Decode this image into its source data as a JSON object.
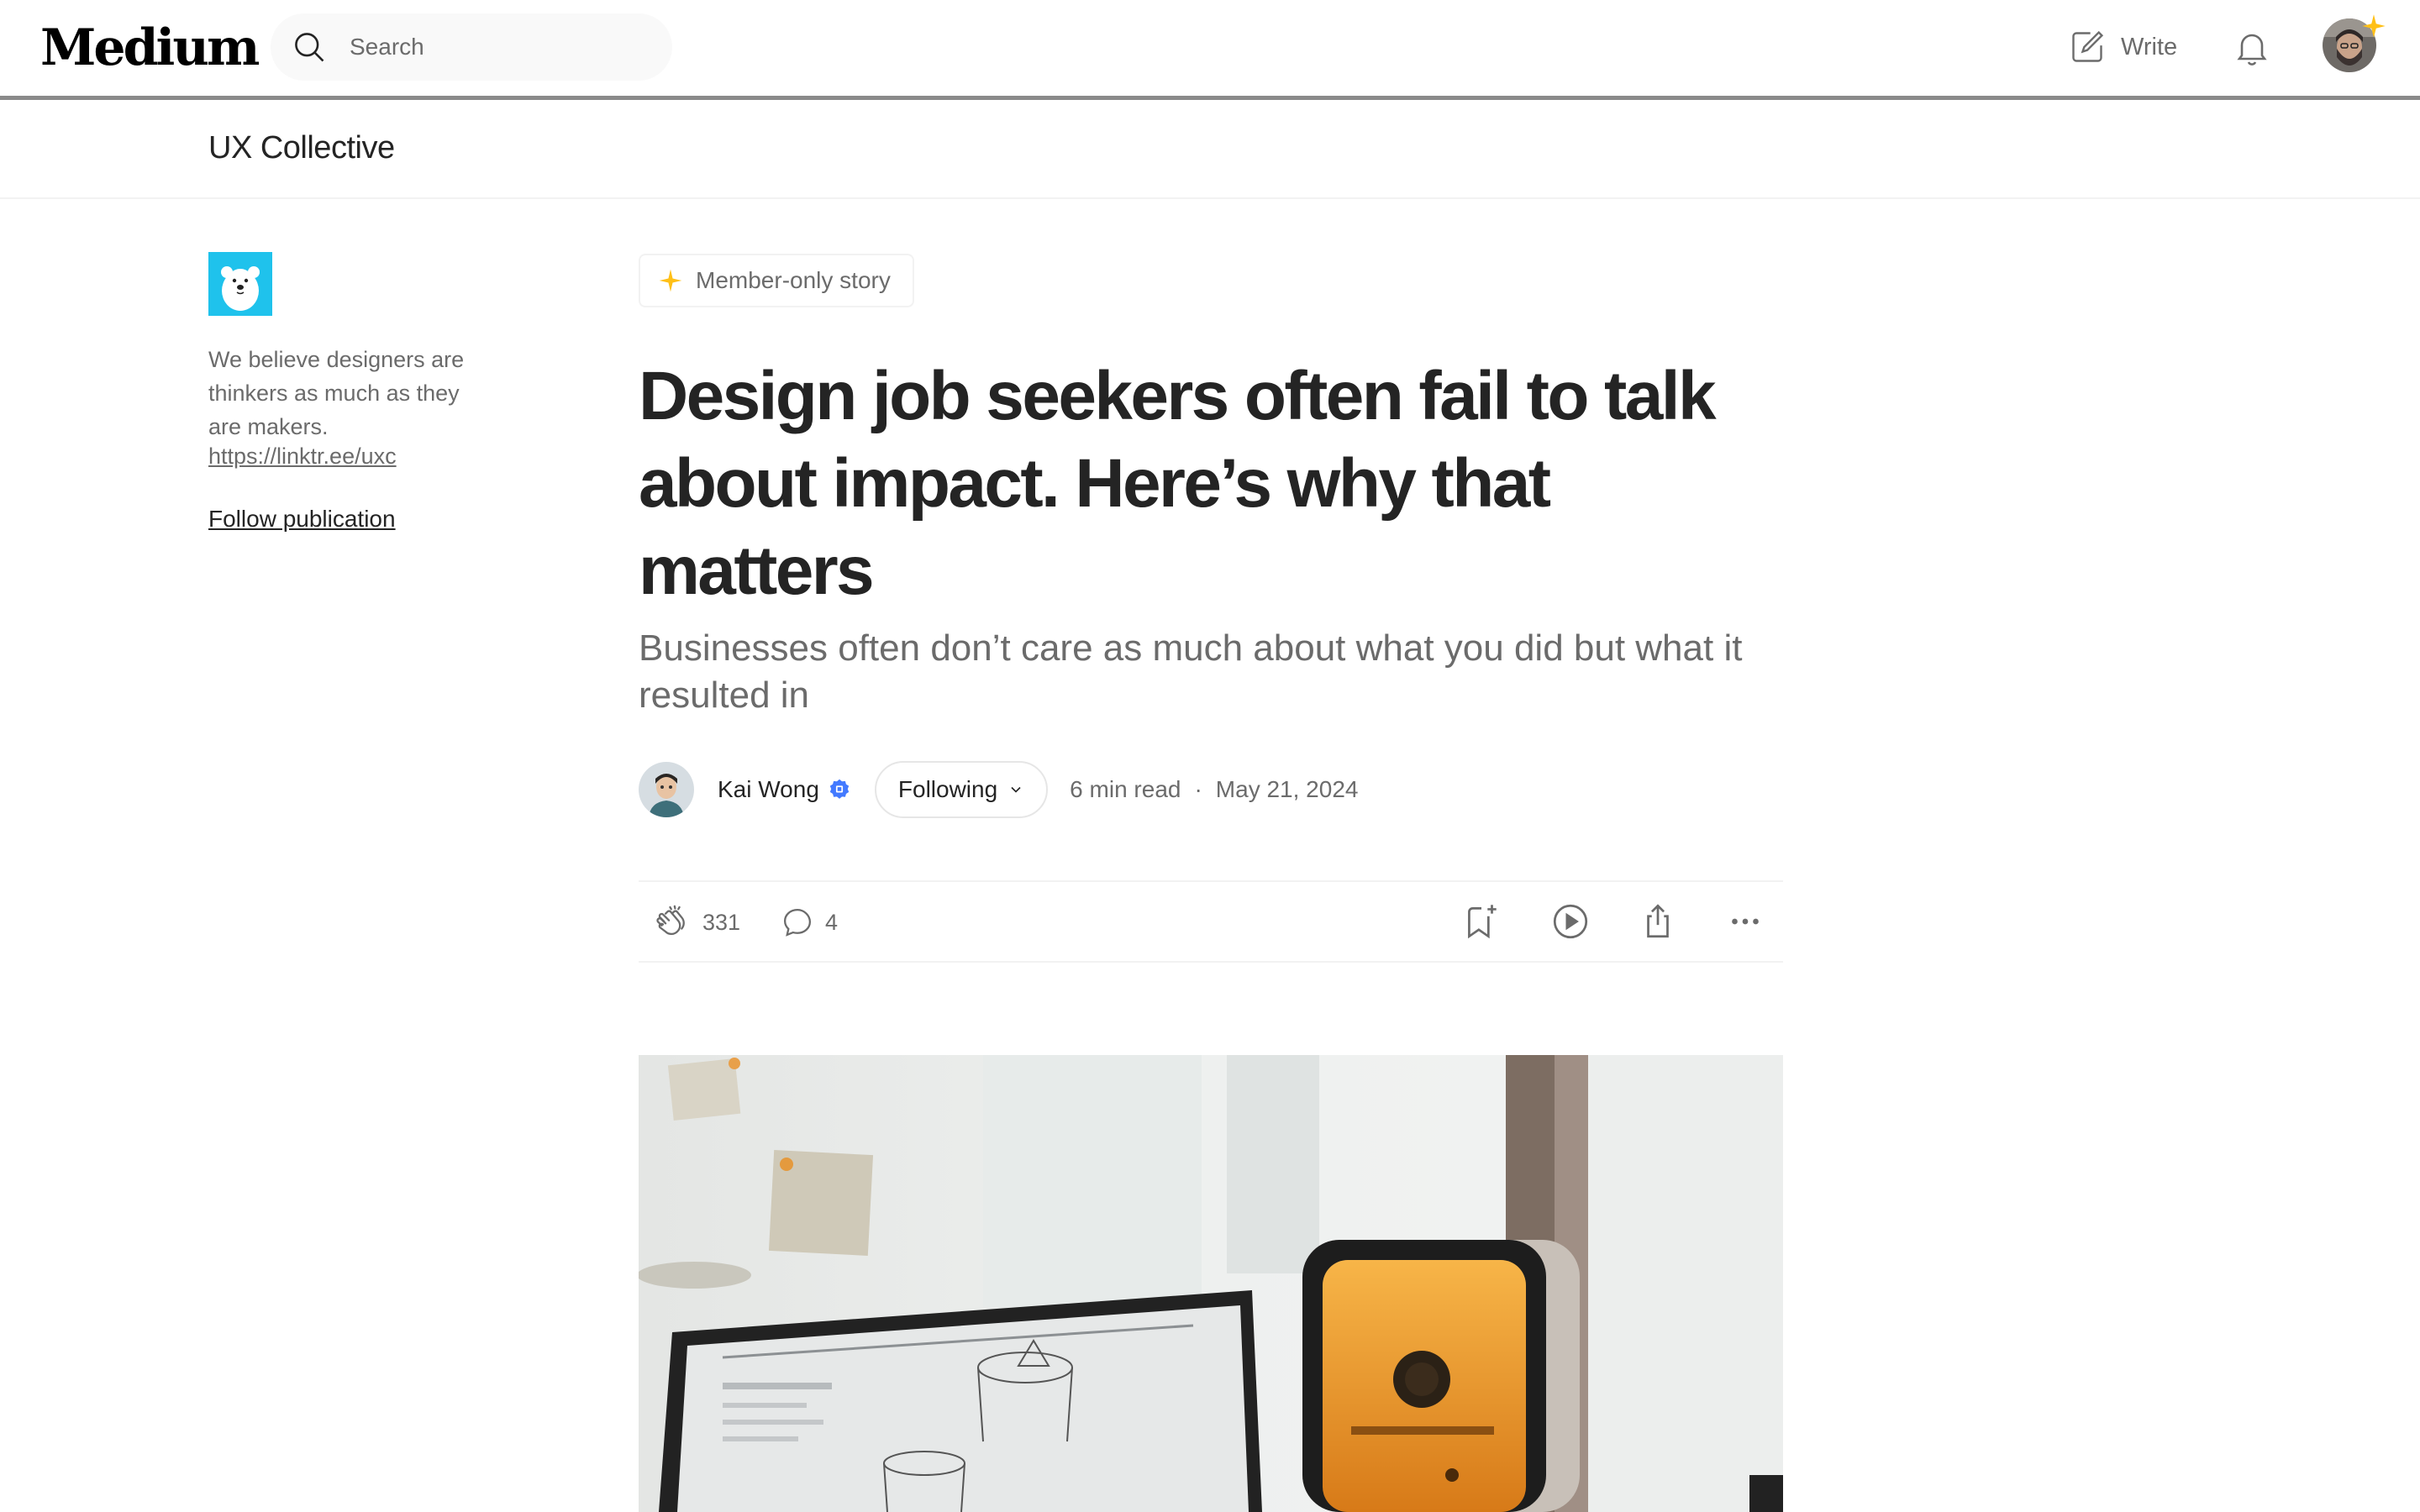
{
  "header": {
    "logo": "Medium",
    "search_placeholder": "Search",
    "write_label": "Write"
  },
  "publication": {
    "name": "UX Collective",
    "description": "We believe designers are thinkers as much as they are makers.",
    "link": "https://linktr.ee/uxc",
    "follow_label": "Follow publication"
  },
  "article": {
    "badge": "Member-only story",
    "title": "Design job seekers often fail to talk about impact. Here’s why that matters",
    "subtitle": "Businesses often don’t care as much about what you did but what it resulted in",
    "author": "Kai Wong",
    "following_label": "Following",
    "read_time": "6 min read",
    "separator": "·",
    "date": "May 21, 2024"
  },
  "actions": {
    "claps": "331",
    "comments": "4"
  },
  "colors": {
    "accent_star": "#FFC017",
    "verified_blue": "#437AFF",
    "text_primary": "#242424",
    "text_secondary": "#6B6B6B"
  }
}
